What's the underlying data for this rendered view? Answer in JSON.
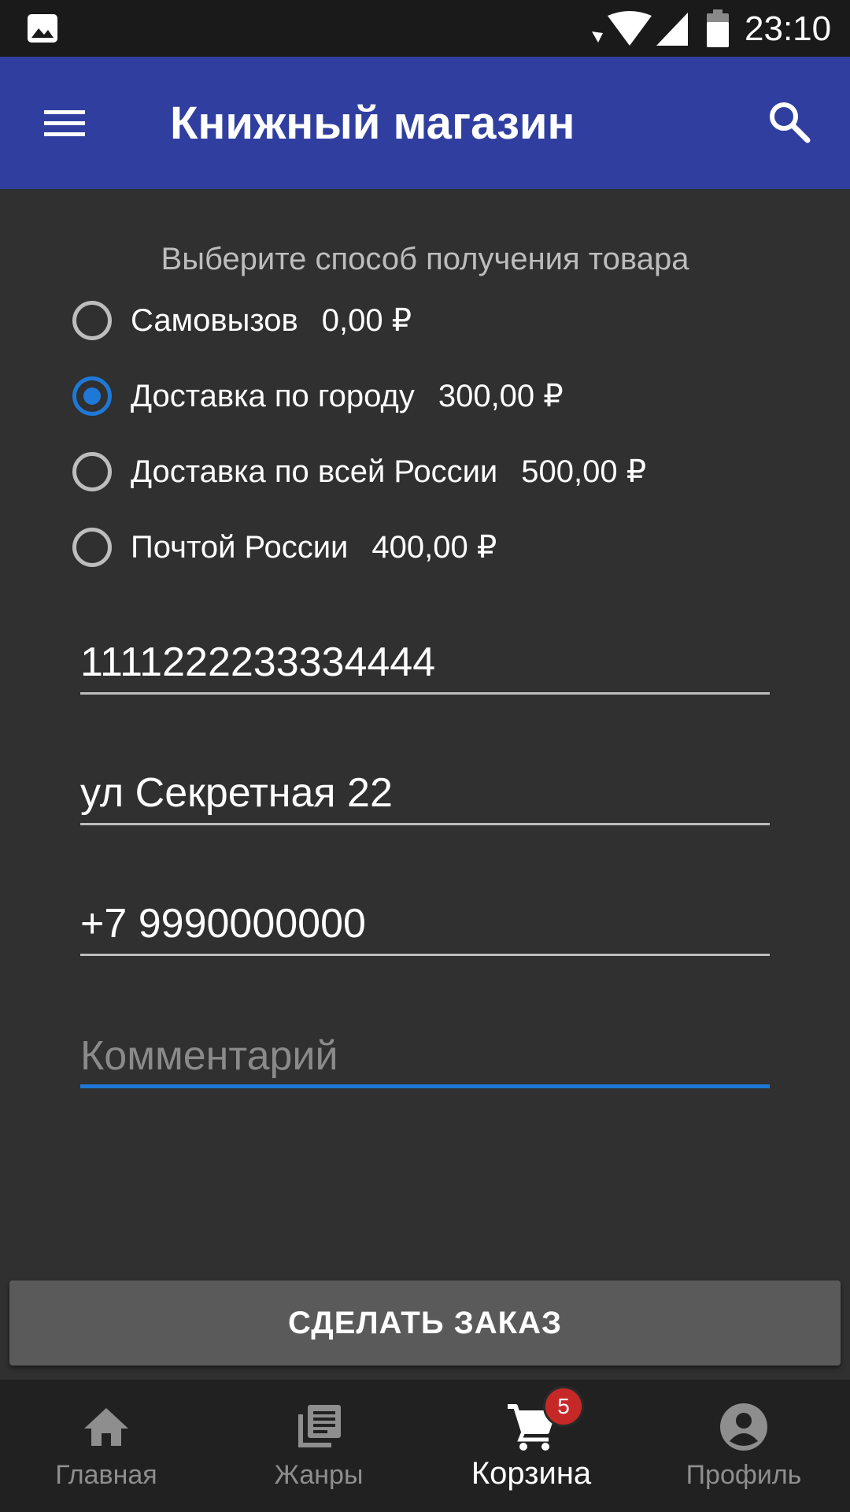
{
  "status_bar": {
    "time": "23:10",
    "icons": [
      "gallery-icon",
      "wifi-icon",
      "signal-icon",
      "battery-icon"
    ]
  },
  "app_bar": {
    "title": "Книжный магазин",
    "menu_icon": "menu-icon",
    "search_icon": "search-icon",
    "color": "#303f9f"
  },
  "delivery": {
    "heading": "Выберите способ получения товара",
    "options": [
      {
        "label": "Самовызов",
        "price": "0,00 ₽",
        "selected": false
      },
      {
        "label": "Доставка по городу",
        "price": "300,00 ₽",
        "selected": true
      },
      {
        "label": "Доставка по всей России",
        "price": "500,00 ₽",
        "selected": false
      },
      {
        "label": "Почтой России",
        "price": "400,00 ₽",
        "selected": false
      }
    ]
  },
  "form": {
    "card_number": "1111222233334444",
    "address": "ул Секретная 22",
    "phone": "+7 9990000000",
    "comment_placeholder": "Комментарий",
    "comment_value": ""
  },
  "order_button": {
    "label": "СДЕЛАТЬ ЗАКАЗ"
  },
  "bottom_nav": {
    "items": [
      {
        "label": "Главная",
        "icon": "home-icon",
        "active": false
      },
      {
        "label": "Жанры",
        "icon": "library-icon",
        "active": false
      },
      {
        "label": "Корзина",
        "icon": "cart-icon",
        "active": true,
        "badge": "5"
      },
      {
        "label": "Профиль",
        "icon": "account-icon",
        "active": false
      }
    ]
  },
  "colors": {
    "accent": "#1e78d7",
    "background": "#303030",
    "badge": "#c62828"
  }
}
